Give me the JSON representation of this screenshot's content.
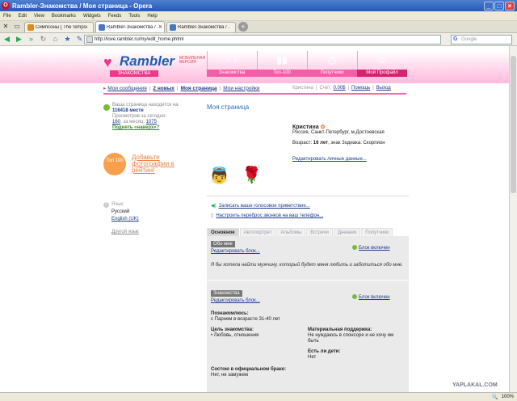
{
  "window": {
    "title": "Rambler-Знакомства / Моя страница - Opera"
  },
  "menu": [
    "File",
    "Edit",
    "View",
    "Bookmarks",
    "Widgets",
    "Feeds",
    "Tools",
    "Help"
  ],
  "tabs": [
    {
      "label": "Симпсоны [ The Simpso...",
      "fav": "#e28a1c"
    },
    {
      "label": "Rambler-Знакомства / ...",
      "fav": "#4a78c0"
    },
    {
      "label": "Rambler-Знакомства / ...",
      "fav": "#4a78c0"
    }
  ],
  "address": "http://love.rambler.ru/my/edit_home.phtml",
  "search_placeholder": "Google",
  "status": {
    "zoom": "100%",
    "watermark": "YAPLAKAL.COM"
  },
  "header": {
    "brand": "Rambler",
    "brand_sub": "ЗНАКОМСТВА",
    "mobile": "МОБИЛЬНАЯ ВЕРСИЯ",
    "nav": [
      {
        "label": "Знакомства",
        "icon": "♂♀"
      },
      {
        "label": "Топ-100",
        "icon": "▮▮"
      },
      {
        "label": "Попутчики",
        "icon": "◷"
      },
      {
        "label": "Мой Профайл",
        "icon": "☺"
      }
    ]
  },
  "subnav": {
    "messages": "Мои сообщения",
    "new": "2 новых",
    "mypage": "Моя страница",
    "settings": "Мои настройки"
  },
  "userline": {
    "name": "Кристина",
    "account_label": "Счет:",
    "account": "0.00$",
    "help": "Помощь",
    "exit": "Выход"
  },
  "left": {
    "position_text": "Ваша страница находится на",
    "position": "116418 месте",
    "views_label": "Просмотров за сегодня:",
    "views_today": "160",
    "month_label": "за месяц:",
    "views_month": "1075",
    "raise": "Поднять «наверх»?",
    "top100": "Топ 100",
    "add_photo": "Добавьте фотографии в рейтинг",
    "lang_label": "Язык:",
    "lang_ru": "Русский",
    "lang_en": "English (UK)",
    "other": "Другой язык"
  },
  "profile": {
    "heading": "Моя страница",
    "name": "Кристина",
    "city": "Россия, Санкт-Петербург, м.Достоевская",
    "age_label": "Возраст:",
    "age": "16 лет",
    "zodiac": ", знак Зодиака: Скорпион",
    "edit": "Редактировать личные данные..."
  },
  "actions": {
    "voice": "Записать ваше голосовое приветствие...",
    "calls": "Настроить переброс звонков на ваш телефон..."
  },
  "profile_tabs": [
    "Основное",
    "Автопортрет",
    "Альбомы",
    "Встречи",
    "Дневник",
    "Попутчики"
  ],
  "blocks": {
    "about_label": "Обо мне",
    "edit": "Редактировать блок...",
    "on": "Блок включен",
    "about_text": "Я бы хотела найти мужчину, который будет меня любить и заботиться обо мне.",
    "dating_label": "Знакомства",
    "meet_title": "Познакомлюсь:",
    "meet_value": "с Парнем в возрасте 31-40 лет",
    "goal_title": "Цель знакомства:",
    "goal_value": "•  Любовь, отношения",
    "support_title": "Материальная поддержка:",
    "support_value": "Не нуждаюсь в спонсоре и не хочу им быть",
    "kids_title": "Есть ли дети:",
    "kids_value": "Нет",
    "married_title": "Состою в официальном браке:",
    "married_value": "Нет, не замужем"
  }
}
